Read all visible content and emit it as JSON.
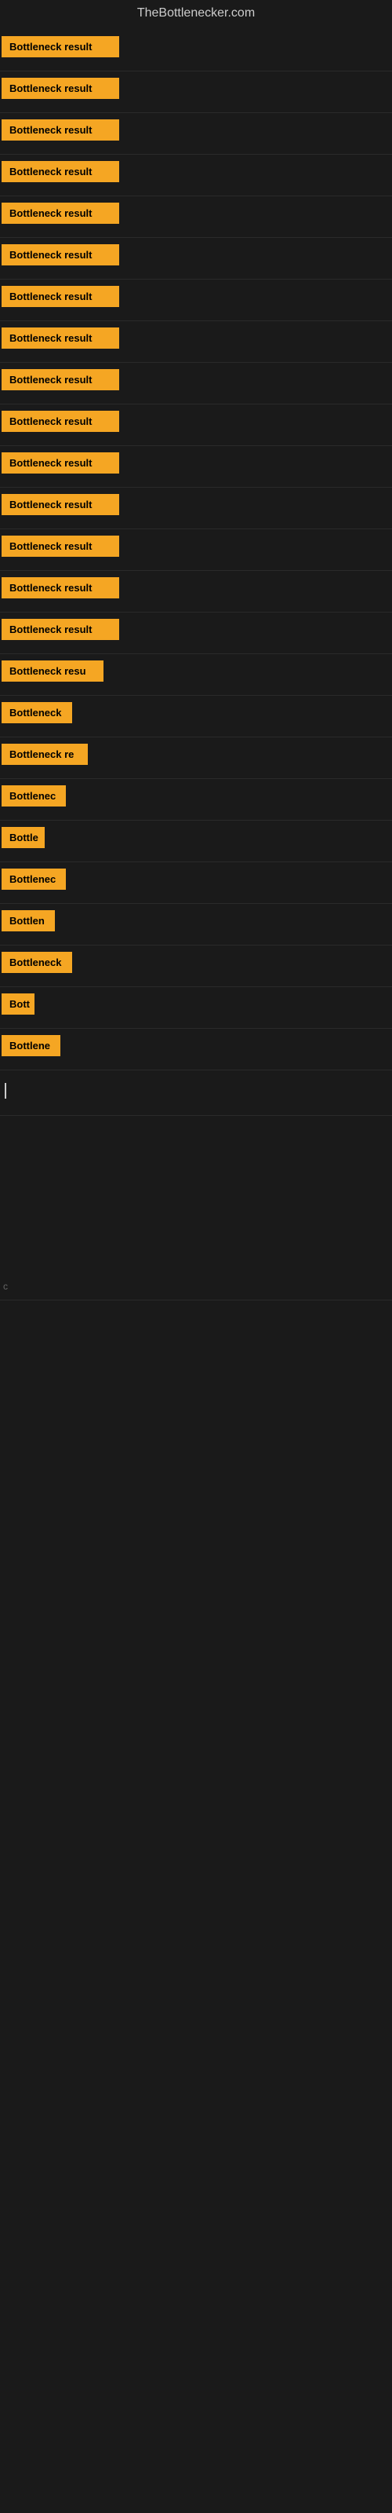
{
  "header": {
    "title": "TheBottlenecker.com"
  },
  "bars": [
    {
      "label": "Bottleneck result",
      "width": 150
    },
    {
      "label": "Bottleneck result",
      "width": 150
    },
    {
      "label": "Bottleneck result",
      "width": 150
    },
    {
      "label": "Bottleneck result",
      "width": 150
    },
    {
      "label": "Bottleneck result",
      "width": 150
    },
    {
      "label": "Bottleneck result",
      "width": 150
    },
    {
      "label": "Bottleneck result",
      "width": 150
    },
    {
      "label": "Bottleneck result",
      "width": 150
    },
    {
      "label": "Bottleneck result",
      "width": 150
    },
    {
      "label": "Bottleneck result",
      "width": 150
    },
    {
      "label": "Bottleneck result",
      "width": 150
    },
    {
      "label": "Bottleneck result",
      "width": 150
    },
    {
      "label": "Bottleneck result",
      "width": 150
    },
    {
      "label": "Bottleneck result",
      "width": 150
    },
    {
      "label": "Bottleneck result",
      "width": 150
    },
    {
      "label": "Bottleneck resu",
      "width": 130
    },
    {
      "label": "Bottleneck",
      "width": 90
    },
    {
      "label": "Bottleneck re",
      "width": 110
    },
    {
      "label": "Bottlenec",
      "width": 82
    },
    {
      "label": "Bottle",
      "width": 55
    },
    {
      "label": "Bottlenec",
      "width": 82
    },
    {
      "label": "Bottlen",
      "width": 68
    },
    {
      "label": "Bottleneck",
      "width": 90
    },
    {
      "label": "Bott",
      "width": 42
    },
    {
      "label": "Bottlene",
      "width": 75
    }
  ],
  "colors": {
    "bar_bg": "#f5a623",
    "bar_text": "#000000",
    "header_text": "#cccccc",
    "bg": "#1a1a1a"
  }
}
